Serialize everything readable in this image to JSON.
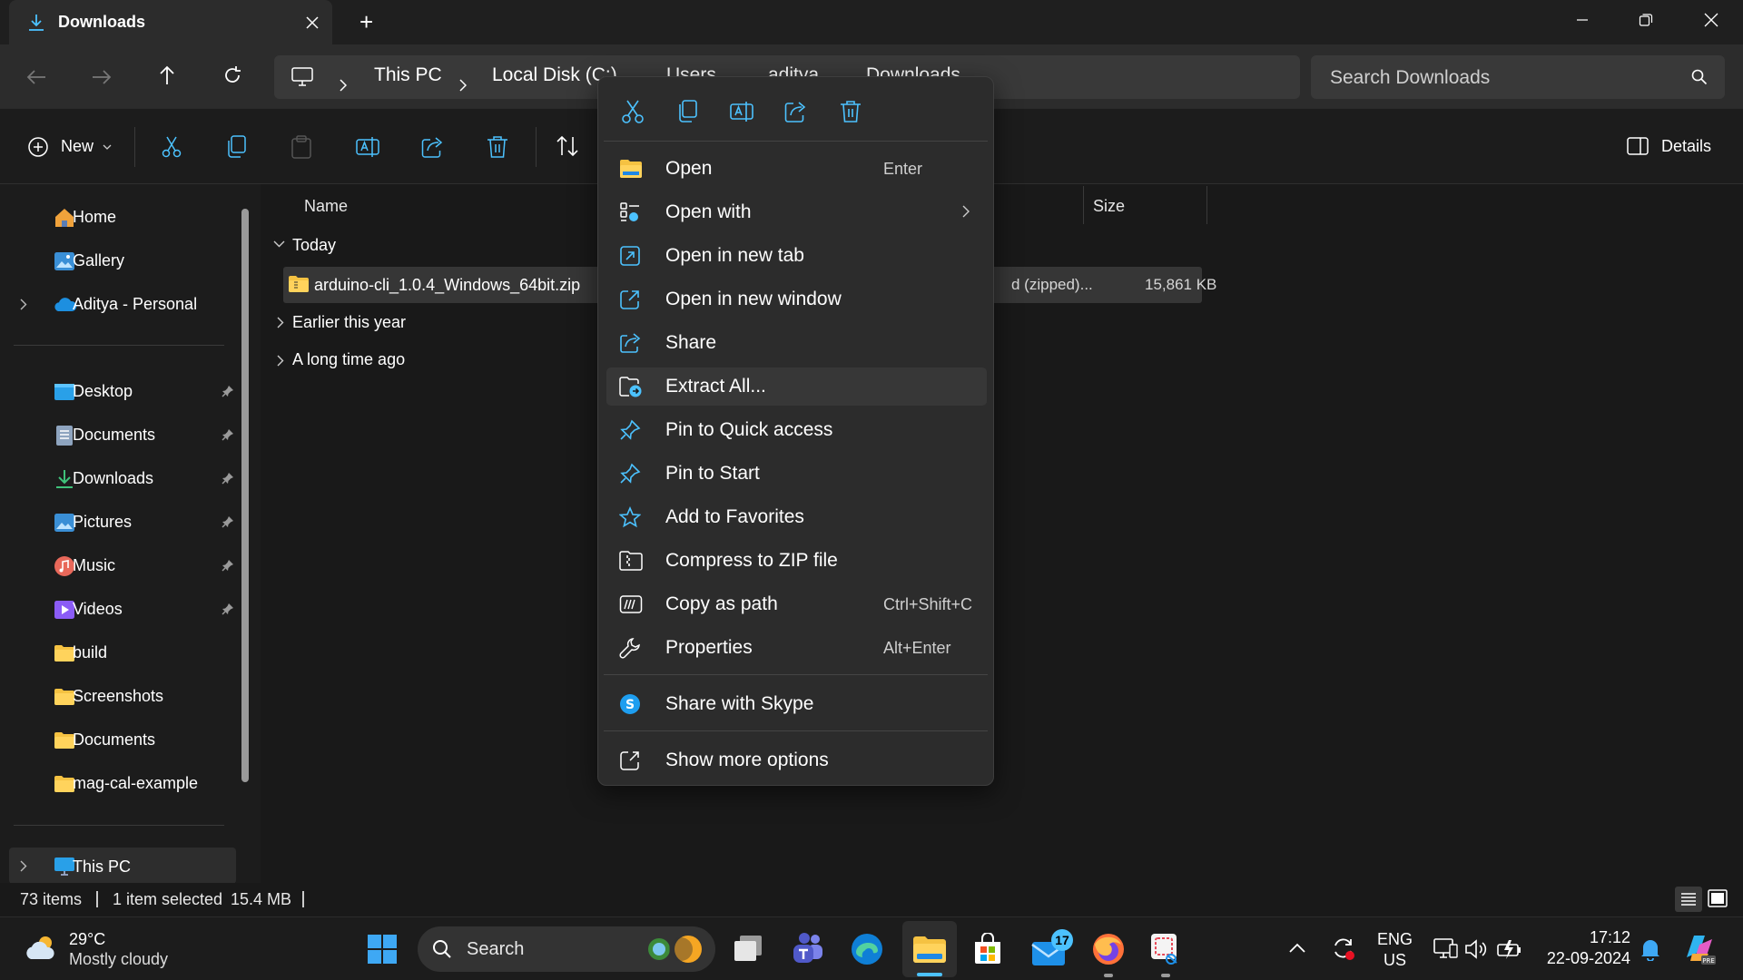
{
  "window": {
    "tab_title": "Downloads",
    "new_tab": "+"
  },
  "breadcrumb": [
    "This PC",
    "Local Disk (C:)",
    "Users",
    "aditya",
    "Downloads"
  ],
  "search": {
    "placeholder": "Search Downloads"
  },
  "toolbar": {
    "new_label": "New",
    "sort_label": "Sort",
    "details_label": "Details"
  },
  "sidebar": {
    "top": [
      {
        "label": "Home",
        "icon": "home-icon"
      },
      {
        "label": "Gallery",
        "icon": "gallery-icon"
      },
      {
        "label": "Aditya - Personal",
        "icon": "onedrive-icon"
      }
    ],
    "quick": [
      {
        "label": "Desktop",
        "icon": "desktop-folder-icon"
      },
      {
        "label": "Documents",
        "icon": "documents-folder-icon"
      },
      {
        "label": "Downloads",
        "icon": "downloads-folder-icon"
      },
      {
        "label": "Pictures",
        "icon": "pictures-folder-icon"
      },
      {
        "label": "Music",
        "icon": "music-folder-icon"
      },
      {
        "label": "Videos",
        "icon": "videos-folder-icon"
      },
      {
        "label": "build",
        "icon": "folder-icon"
      },
      {
        "label": "Screenshots",
        "icon": "folder-icon"
      },
      {
        "label": "Documents",
        "icon": "folder-icon"
      },
      {
        "label": "mag-cal-example",
        "icon": "folder-icon"
      }
    ],
    "this_pc": "This PC"
  },
  "content": {
    "columns": {
      "name": "Name",
      "size": "Size"
    },
    "groups": {
      "today": "Today",
      "earlier": "Earlier this year",
      "long_ago": "A long time ago"
    },
    "file": {
      "name": "arduino-cli_1.0.4_Windows_64bit.zip",
      "type": "d (zipped)...",
      "size": "15,861 KB"
    }
  },
  "status": {
    "count": "73 items",
    "selected": "1 item selected",
    "size": "15.4 MB"
  },
  "context_menu": {
    "quick_actions": [
      "cut-icon",
      "copy-icon",
      "rename-icon",
      "share-icon",
      "delete-icon"
    ],
    "items": [
      {
        "label": "Open",
        "shortcut": "Enter",
        "icon": "folder-zip-icon"
      },
      {
        "label": "Open with",
        "shortcut": "",
        "icon": "open-with-icon"
      },
      {
        "label": "Open in new tab",
        "shortcut": "",
        "icon": "new-tab-icon"
      },
      {
        "label": "Open in new window",
        "shortcut": "",
        "icon": "new-window-icon"
      },
      {
        "label": "Share",
        "shortcut": "",
        "icon": "share-icon"
      },
      {
        "label": "Extract All...",
        "shortcut": "",
        "icon": "extract-icon"
      },
      {
        "label": "Pin to Quick access",
        "shortcut": "",
        "icon": "pin-icon"
      },
      {
        "label": "Pin to Start",
        "shortcut": "",
        "icon": "pin-icon"
      },
      {
        "label": "Add to Favorites",
        "shortcut": "",
        "icon": "star-icon"
      },
      {
        "label": "Compress to ZIP file",
        "shortcut": "",
        "icon": "zip-icon"
      },
      {
        "label": "Copy as path",
        "shortcut": "Ctrl+Shift+C",
        "icon": "copy-path-icon"
      },
      {
        "label": "Properties",
        "shortcut": "Alt+Enter",
        "icon": "wrench-icon"
      }
    ],
    "skype": "Share with Skype",
    "more": "Show more options"
  },
  "taskbar": {
    "weather_temp": "29°C",
    "weather_desc": "Mostly cloudy",
    "search_label": "Search",
    "mail_badge": "17",
    "lang_top": "ENG",
    "lang_bottom": "US",
    "time": "17:12",
    "date": "22-09-2024"
  },
  "colors": {
    "accent": "#4cc2ff",
    "folder": "#f5c242",
    "menu_bg": "#2c2c2c"
  }
}
